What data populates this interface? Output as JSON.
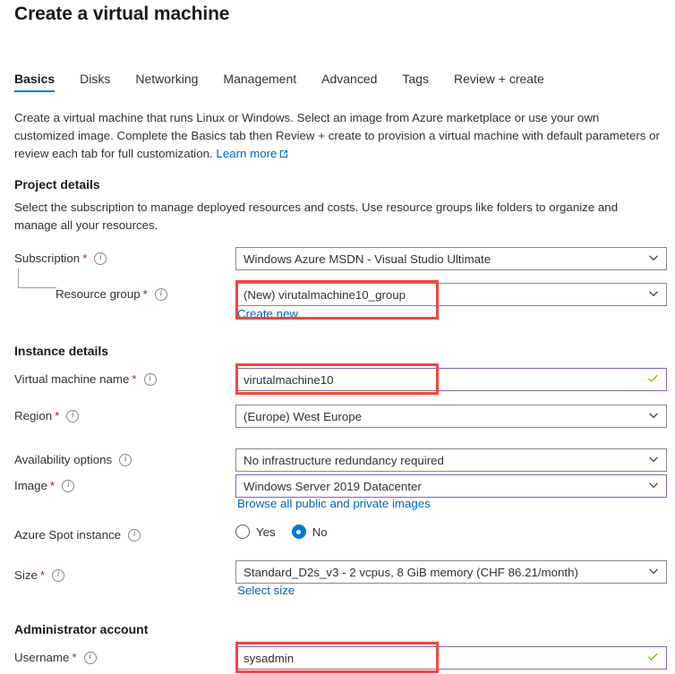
{
  "header": {
    "title": "Create a virtual machine"
  },
  "tabs": [
    {
      "label": "Basics",
      "active": true
    },
    {
      "label": "Disks",
      "active": false
    },
    {
      "label": "Networking",
      "active": false
    },
    {
      "label": "Management",
      "active": false
    },
    {
      "label": "Advanced",
      "active": false
    },
    {
      "label": "Tags",
      "active": false
    },
    {
      "label": "Review + create",
      "active": false
    }
  ],
  "intro": {
    "text": "Create a virtual machine that runs Linux or Windows. Select an image from Azure marketplace or use your own customized image. Complete the Basics tab then Review + create to provision a virtual machine with default parameters or review each tab for full customization.",
    "link_label": "Learn more",
    "link_icon": "external-link-icon"
  },
  "project_details": {
    "heading": "Project details",
    "description": "Select the subscription to manage deployed resources and costs. Use resource groups like folders to organize and manage all your resources.",
    "subscription": {
      "label": "Subscription",
      "required": "*",
      "value": "Windows Azure MSDN - Visual Studio Ultimate"
    },
    "resource_group": {
      "label": "Resource group",
      "required": "*",
      "value": "(New) virutalmachine10_group",
      "sublink": "Create new"
    }
  },
  "instance_details": {
    "heading": "Instance details",
    "vm_name": {
      "label": "Virtual machine name",
      "required": "*",
      "value": "virutalmachine10",
      "valid": true
    },
    "region": {
      "label": "Region",
      "required": "*",
      "value": "(Europe) West Europe"
    },
    "availability": {
      "label": "Availability options",
      "required": "",
      "value": "No infrastructure redundancy required"
    },
    "image": {
      "label": "Image",
      "required": "*",
      "value": "Windows Server 2019 Datacenter",
      "sublink": "Browse all public and private images"
    },
    "spot_instance": {
      "label": "Azure Spot instance",
      "required": "",
      "options": [
        {
          "label": "Yes",
          "selected": false
        },
        {
          "label": "No",
          "selected": true
        }
      ]
    },
    "size": {
      "label": "Size",
      "required": "*",
      "value": "Standard_D2s_v3 - 2 vcpus, 8 GiB memory (CHF 86.21/month)",
      "sublink": "Select size"
    }
  },
  "administrator_account": {
    "heading": "Administrator account",
    "username": {
      "label": "Username",
      "required": "*",
      "value": "sysadmin",
      "valid": true
    }
  },
  "colors": {
    "accent": "#0078d4",
    "link": "#0067b8",
    "required": "#a4262c",
    "annotation": "#f4453c",
    "focus_border": "#8764b8",
    "valid_check": "#6bb700"
  },
  "annotations": [
    {
      "name": "resource-group-highlight"
    },
    {
      "name": "vm-name-highlight"
    },
    {
      "name": "username-highlight"
    }
  ]
}
